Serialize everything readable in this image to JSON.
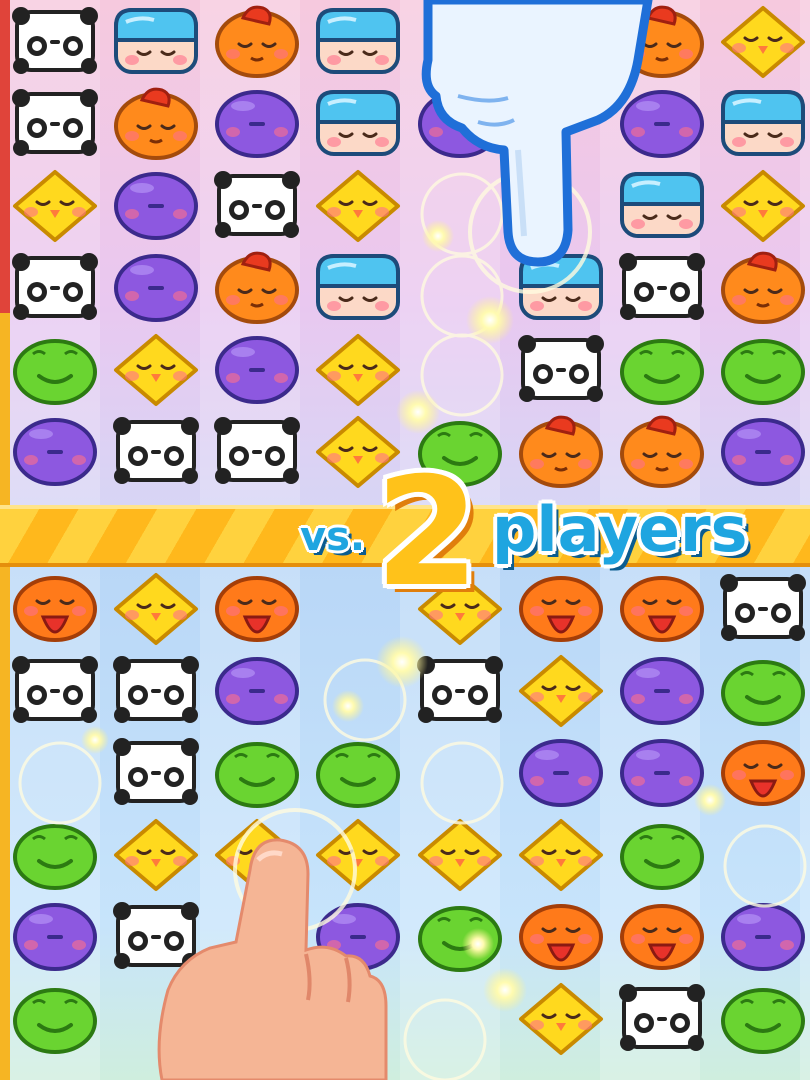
{
  "banner": {
    "vs": "vs.",
    "number": "2",
    "players": "players"
  },
  "colors": {
    "panda": "#ffffff",
    "bird": "#ff8a1c",
    "blue": "#4fc4f0",
    "plum": "#8d58e0",
    "chick": "#ffd91e",
    "frog": "#6ad431",
    "fox": "#ff7a1a",
    "accent_blue": "#1fa5e0",
    "accent_yellow": "#ffc21a"
  },
  "top_board": {
    "rows": [
      [
        "panda",
        "blue",
        "bird",
        "blue",
        "",
        "",
        "bird",
        "chick"
      ],
      [
        "panda",
        "bird",
        "plum",
        "blue",
        "plum",
        "",
        "plum",
        "blue"
      ],
      [
        "chick",
        "plum",
        "panda",
        "chick",
        "",
        "",
        "blue",
        "chick"
      ],
      [
        "panda",
        "plum",
        "bird",
        "blue",
        "",
        "blue",
        "panda",
        "bird"
      ],
      [
        "frog",
        "chick",
        "plum",
        "chick",
        "",
        "panda",
        "frog",
        "frog"
      ],
      [
        "plum",
        "panda",
        "panda",
        "chick",
        "frog",
        "bird",
        "bird",
        "plum"
      ]
    ]
  },
  "bottom_board": {
    "rows": [
      [
        "fox",
        "chick",
        "fox",
        "",
        "chick",
        "fox",
        "fox",
        "panda"
      ],
      [
        "panda",
        "panda",
        "plum",
        "",
        "panda",
        "chick",
        "plum",
        "frog"
      ],
      [
        "",
        "panda",
        "frog",
        "frog",
        "",
        "plum",
        "plum",
        "fox"
      ],
      [
        "frog",
        "chick",
        "chick",
        "chick",
        "chick",
        "chick",
        "frog",
        ""
      ],
      [
        "plum",
        "panda",
        "",
        "plum",
        "frog",
        "fox",
        "fox",
        "plum"
      ],
      [
        "frog",
        "",
        "",
        "",
        "",
        "chick",
        "panda",
        "frog"
      ]
    ]
  }
}
